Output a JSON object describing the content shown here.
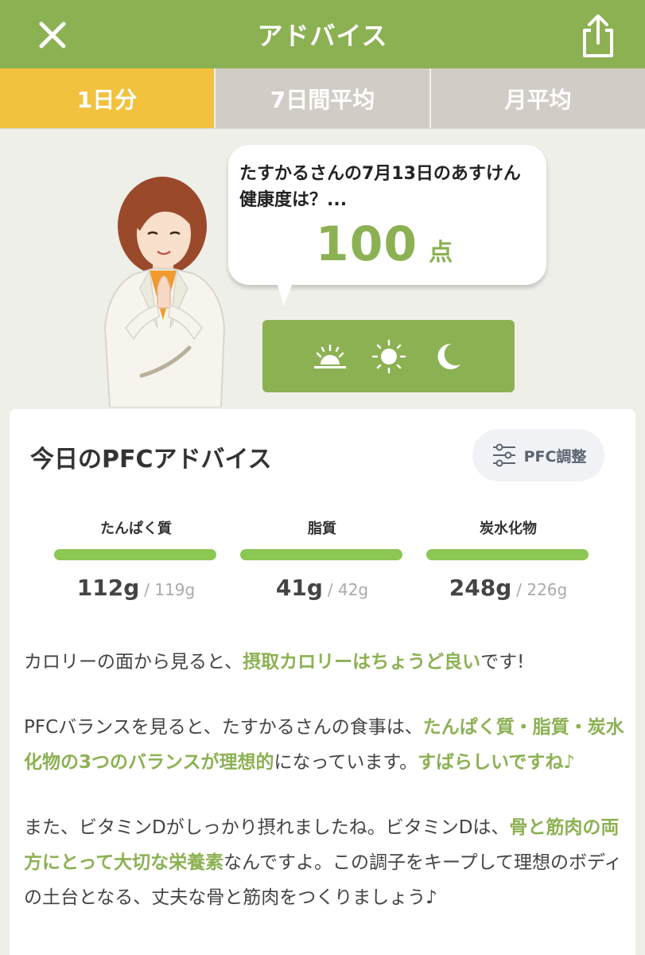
{
  "header": {
    "title": "アドバイス",
    "close_icon": "close-icon",
    "share_icon": "share-icon"
  },
  "tabs": [
    {
      "label": "1日分",
      "active": true
    },
    {
      "label": "7日間平均",
      "active": false
    },
    {
      "label": "月平均",
      "active": false
    }
  ],
  "bubble": {
    "text": "たすかるさんの7月13日のあすけん健康度は？...",
    "score": "100",
    "score_unit": "点"
  },
  "time_buttons": [
    {
      "icon": "sunrise-icon"
    },
    {
      "icon": "sun-icon"
    },
    {
      "icon": "moon-icon"
    }
  ],
  "card": {
    "title": "今日のPFCアドバイス",
    "pfc_button_label": "PFC調整",
    "nutrients": [
      {
        "name": "たんぱく質",
        "value": "112g",
        "target": "/ 119g",
        "ratio": 1.0
      },
      {
        "name": "脂質",
        "value": "41g",
        "target": "/ 42g",
        "ratio": 1.0
      },
      {
        "name": "炭水化物",
        "value": "248g",
        "target": "/ 226g",
        "ratio": 1.0
      }
    ]
  },
  "advice": {
    "p1": {
      "a": "カロリーの面から見ると、",
      "b": "摂取カロリーはちょうど良い",
      "c": "です!"
    },
    "p2": {
      "a": "PFCバランスを見ると、たすかるさんの食事は、",
      "b": "たんぱく質・脂質・炭水化物の3つのバランスが理想的",
      "c": "になっています。",
      "d": "すばらしいですね♪"
    },
    "p3": {
      "a": "また、ビタミンDがしっかり摂れましたね。ビタミンDは、",
      "b": "骨と筋肉の両方にとって大切な栄養素",
      "c": "なんですよ。この調子をキープして理想のボディの土台となる、丈夫な骨と筋肉をつくりましょう♪"
    }
  },
  "colors": {
    "brand_green": "#8cb153",
    "tab_active": "#f2c23e",
    "tab_inactive": "#d2ccc6",
    "bar_green": "#8cc653"
  }
}
